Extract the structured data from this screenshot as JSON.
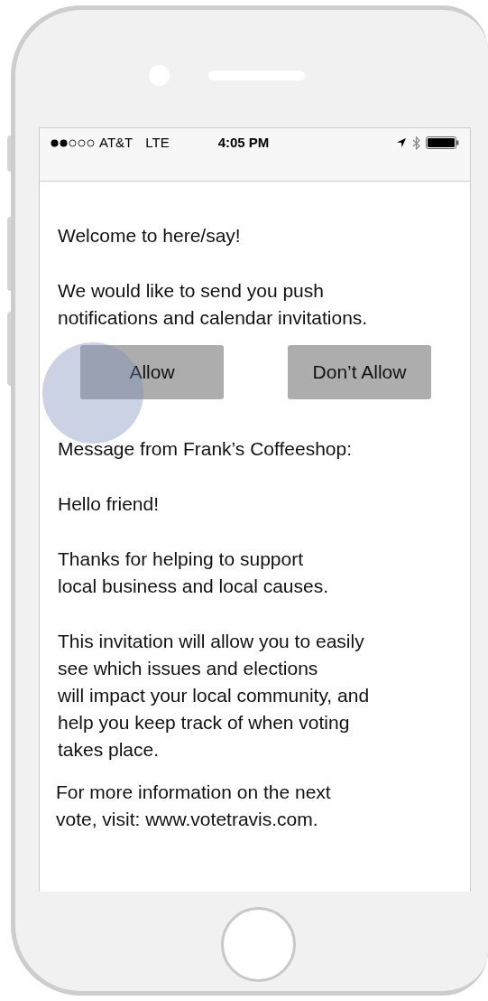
{
  "status_bar": {
    "carrier": "AT&T",
    "network": "LTE",
    "time": "4:05 PM"
  },
  "welcome": "Welcome to here/say!",
  "prompt": {
    "lines": [
      "We would like to send you push",
      "notifications and calendar invitations."
    ]
  },
  "buttons": [
    "Allow",
    "Don’t Allow"
  ],
  "message": [
    {
      "lines": [
        "Message from Frank’s Coffeeshop:"
      ]
    },
    {
      "lines": [
        "Hello friend!"
      ]
    },
    {
      "lines": [
        "Thanks for helping to support",
        "local business and local causes."
      ]
    },
    {
      "lines": [
        "This invitation will allow you to easily",
        "see which issues and elections",
        "will impact your local community, and",
        "help you keep track of when voting",
        "takes place."
      ]
    },
    {
      "lines": [
        "For more information on the next",
        "vote, visit: www.votetravis.com."
      ]
    }
  ]
}
